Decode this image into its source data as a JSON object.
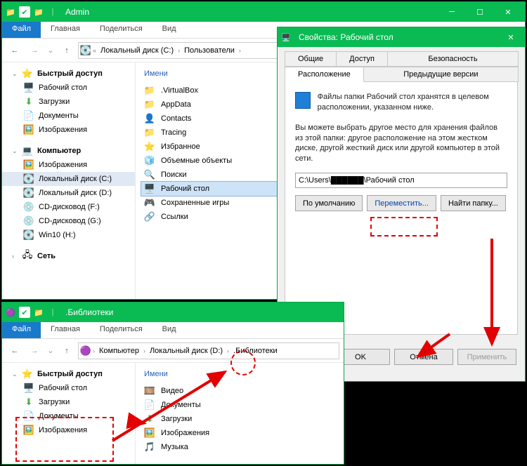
{
  "win1": {
    "title": "Admin",
    "ribbon": {
      "file": "Файл",
      "home": "Главная",
      "share": "Поделиться",
      "view": "Вид"
    },
    "crumbs": [
      "Локальный диск (C:)",
      "Пользователи"
    ],
    "nav": {
      "quick": "Быстрый доступ",
      "desktop": "Рабочий стол",
      "downloads": "Загрузки",
      "documents": "Документы",
      "pictures": "Изображения",
      "computer": "Компьютер",
      "pictures2": "Изображения",
      "diskC": "Локальный диск (C:)",
      "diskD": "Локальный диск (D:)",
      "cdF": "CD-дисковод (F:)",
      "cdG": "CD-дисковод (G:)",
      "win10": "Win10 (H:)",
      "network": "Сеть"
    },
    "contentHeader": "Имени",
    "items": {
      "vbox": ".VirtualBox",
      "appdata": "AppData",
      "contacts": "Contacts",
      "tracing": "Tracing",
      "fav": "Избранное",
      "obj3d": "Объемные объекты",
      "search": "Поиски",
      "desktop": "Рабочий стол",
      "saved": "Сохраненные игры",
      "links": "Ссылки"
    }
  },
  "props": {
    "title": "Свойства: Рабочий стол",
    "tabs": {
      "general": "Общие",
      "access": "Доступ",
      "security": "Безопасность",
      "location": "Расположение",
      "prev": "Предыдущие версии"
    },
    "line1": "Файлы папки Рабочий стол хранятся в целевом расположении, указанном ниже.",
    "line2": "Вы можете выбрать другое место для хранения файлов из этой папки: другое расположение на этом жестком диске, другой жесткий диск или другой компьютер в этой сети.",
    "path": "C:\\Users\\██████\\Рабочий стол",
    "btnDefault": "По умолчанию",
    "btnMove": "Переместить...",
    "btnFind": "Найти папку...",
    "ok": "OK",
    "cancel": "Отмена",
    "apply": "Применить"
  },
  "win2": {
    "title": ".Библиотеки",
    "ribbon": {
      "file": "Файл",
      "home": "Главная",
      "share": "Поделиться",
      "view": "Вид"
    },
    "crumbs": [
      "Компьютер",
      "Локальный диск (D:)",
      ".Библиотеки"
    ],
    "nav": {
      "quick": "Быстрый доступ",
      "desktop": "Рабочий стол",
      "downloads": "Загрузки",
      "documents": "Документы",
      "pictures": "Изображения"
    },
    "contentHeader": "Имени",
    "items": {
      "video": "Видео",
      "docs": "Документы",
      "down": "Загрузки",
      "pics": "Изображения",
      "music": "Музыка"
    }
  }
}
